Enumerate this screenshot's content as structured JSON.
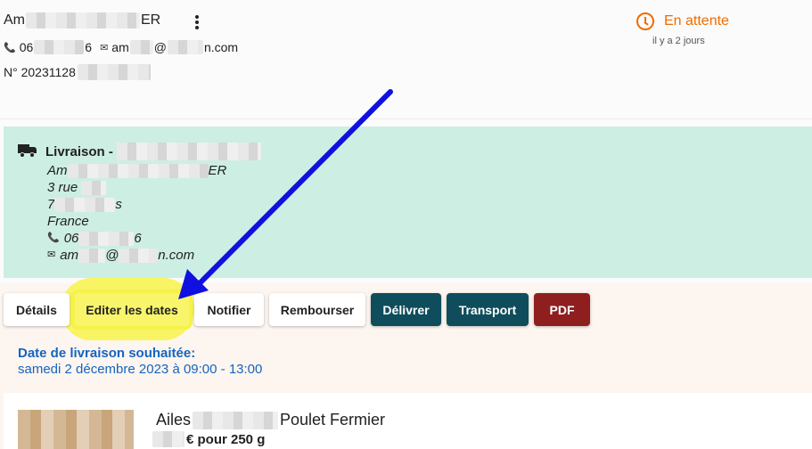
{
  "header": {
    "name_prefix": "Am",
    "name_suffix": "ER",
    "phone_prefix": "06",
    "phone_suffix": "6",
    "email_prefix": "am",
    "email_suffix": "n.com",
    "email_at": "@",
    "order_prefix": "N° 20231128",
    "status": "En attente",
    "since": "il y a 2 jours"
  },
  "delivery": {
    "title": "Livraison -",
    "name_prefix": "Am",
    "name_suffix": "ER",
    "street": "3 rue",
    "city_prefix": "7",
    "city_suffix": "s",
    "country": "France",
    "phone_prefix": "06",
    "phone_suffix": "6",
    "email_prefix": "am",
    "email_at": "@",
    "email_suffix": "n.com"
  },
  "actions": {
    "details": "Détails",
    "edit_dates": "Editer les dates",
    "notify": "Notifier",
    "refund": "Rembourser",
    "deliver": "Délivrer",
    "transport": "Transport",
    "pdf": "PDF"
  },
  "schedule": {
    "label": "Date de livraison souhaitée:",
    "value": "samedi 2 décembre 2023 à 09:00 - 13:00"
  },
  "product": {
    "name_prefix": "Ailes",
    "name_suffix": "Poulet Fermier",
    "price_suffix": "€ pour 250 g"
  },
  "icons": {
    "more": "more-vert-icon",
    "phone": "phone-icon",
    "mail": "mail-icon",
    "clock": "clock-icon",
    "truck": "truck-icon"
  },
  "colors": {
    "status": "#ef6c00",
    "delivery_panel": "#cdeee3",
    "primary_button": "#0f4d5c",
    "pdf_button": "#8f1f1f",
    "date_text": "#1565c0",
    "annotation_highlight": "#f7f34a",
    "annotation_arrow": "#1010e0"
  }
}
